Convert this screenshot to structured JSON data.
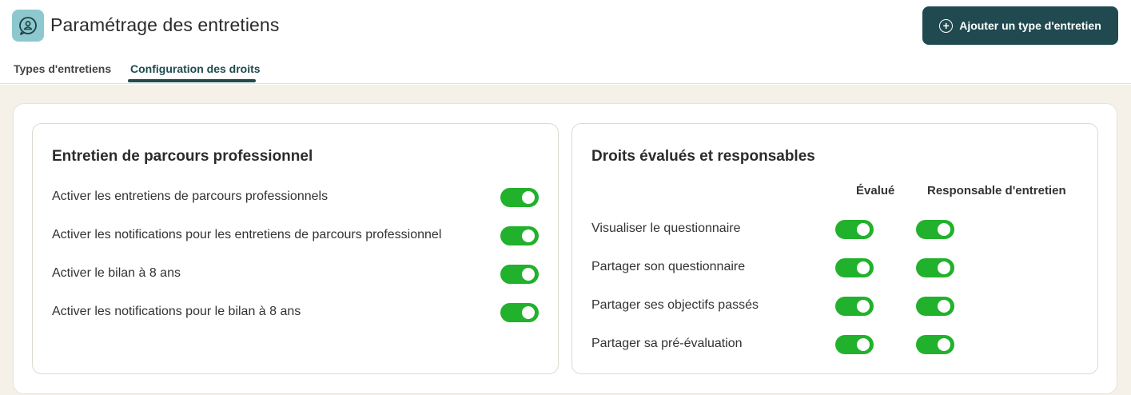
{
  "header": {
    "title": "Paramétrage des entretiens",
    "add_button_label": "Ajouter un type d'entretien",
    "add_icon": "plus-circle-icon",
    "app_icon": "chat-person-icon"
  },
  "tabs": [
    {
      "label": "Types d'entretiens",
      "active": false
    },
    {
      "label": "Configuration des droits",
      "active": true
    }
  ],
  "left_panel": {
    "title": "Entretien de parcours professionnel",
    "settings": [
      {
        "label": "Activer les entretiens de parcours professionnels",
        "enabled": true
      },
      {
        "label": "Activer les notifications pour les entretiens de parcours professionnel",
        "enabled": true
      },
      {
        "label": "Activer le bilan à 8 ans",
        "enabled": true
      },
      {
        "label": "Activer les notifications pour le bilan à 8 ans",
        "enabled": true
      }
    ]
  },
  "right_panel": {
    "title": "Droits évalués et responsables",
    "columns": [
      "Évalué",
      "Responsable d'entretien"
    ],
    "rows": [
      {
        "label": "Visualiser le questionnaire",
        "evalue": true,
        "responsable": true
      },
      {
        "label": "Partager son questionnaire",
        "evalue": true,
        "responsable": true
      },
      {
        "label": "Partager ses objectifs passés",
        "evalue": true,
        "responsable": true
      },
      {
        "label": "Partager sa pré-évaluation",
        "evalue": true,
        "responsable": true
      }
    ]
  },
  "colors": {
    "accent": "#204a50",
    "toggle_on": "#22b12c",
    "page_background": "#f5f1e9",
    "app_icon_bg": "#8cc8cd"
  }
}
